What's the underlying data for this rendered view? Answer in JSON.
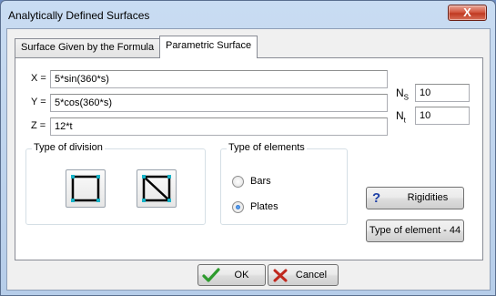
{
  "window": {
    "title": "Analytically Defined Surfaces",
    "close_glyph": "X"
  },
  "tabs": [
    {
      "label": "Surface Given by the Formula",
      "active": false
    },
    {
      "label": "Parametric Surface",
      "active": true
    }
  ],
  "formula": {
    "x_label": "X =",
    "x_value": "5*sin(360*s)",
    "y_label": "Y =",
    "y_value": "5*cos(360*s)",
    "z_label": "Z =",
    "z_value": "12*t"
  },
  "params": {
    "ns_label_main": "N",
    "ns_label_sub": "S",
    "ns_value": "10",
    "nt_label_main": "N",
    "nt_label_sub": "t",
    "nt_value": "10"
  },
  "division": {
    "title": "Type of division",
    "options": [
      {
        "icon": "square-division-icon"
      },
      {
        "icon": "diagonal-division-icon"
      }
    ]
  },
  "elements": {
    "title": "Type of elements",
    "options": [
      {
        "label": "Bars",
        "checked": false
      },
      {
        "label": "Plates",
        "checked": true
      }
    ]
  },
  "rigidities_button": {
    "label": "Rigidities",
    "icon": "question-icon",
    "icon_glyph": "?"
  },
  "type_element_button": {
    "label": "Type of element - 44"
  },
  "ok_button": {
    "label": "OK",
    "icon": "checkmark-icon"
  },
  "cancel_button": {
    "label": "Cancel",
    "icon": "cross-icon"
  },
  "colors": {
    "accent_cyan": "#17b3c8",
    "ok_green": "#2e9b2e",
    "cancel_red": "#c0281e",
    "question_blue": "#1d3fa6"
  }
}
